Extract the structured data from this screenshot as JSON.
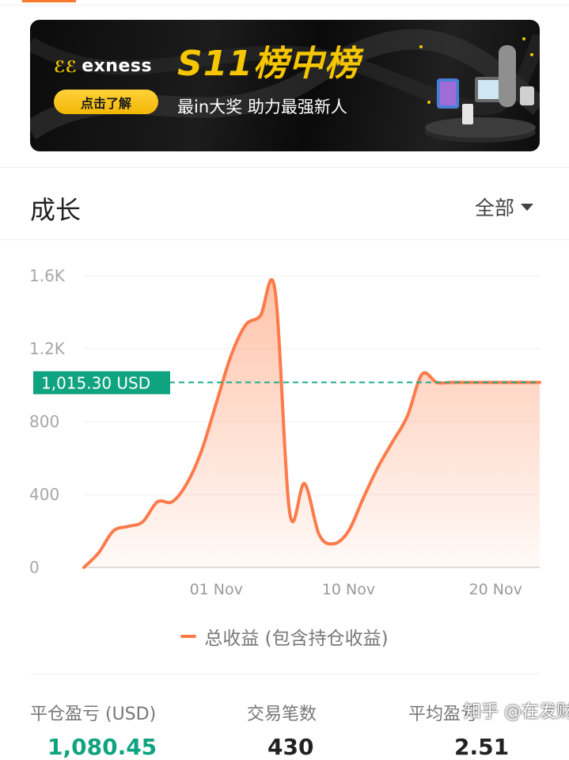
{
  "banner": {
    "brand": "exness",
    "cta": "点击了解",
    "headline": "S11榜中榜",
    "subline": "最in大奖 助力最强新人"
  },
  "section": {
    "title": "成长",
    "filter": "全部"
  },
  "colors": {
    "accent": "#ff7a2e",
    "line": "#ff7a4a",
    "ref_line": "#1aab8a",
    "ref_label_bg": "#10a37f",
    "profit": "#10a37f"
  },
  "chart_data": {
    "type": "area",
    "series": [
      {
        "name": "总收益 (包含持仓收益)",
        "x": [
          "2023-10-23",
          "2023-10-24",
          "2023-10-25",
          "2023-10-26",
          "2023-10-27",
          "2023-10-28",
          "2023-10-29",
          "2023-10-30",
          "2023-10-31",
          "2023-11-01",
          "2023-11-02",
          "2023-11-03",
          "2023-11-04",
          "2023-11-05",
          "2023-11-06",
          "2023-11-07",
          "2023-11-08",
          "2023-11-09",
          "2023-11-10",
          "2023-11-11",
          "2023-11-12",
          "2023-11-13",
          "2023-11-14",
          "2023-11-15",
          "2023-11-16",
          "2023-11-17",
          "2023-11-18",
          "2023-11-19",
          "2023-11-20",
          "2023-11-21",
          "2023-11-22",
          "2023-11-23"
        ],
        "values": [
          0,
          80,
          200,
          225,
          250,
          360,
          360,
          460,
          640,
          900,
          1160,
          1330,
          1380,
          1520,
          300,
          460,
          180,
          130,
          200,
          380,
          550,
          690,
          830,
          1060,
          1015,
          1015,
          1015,
          1015,
          1015,
          1015,
          1015,
          1015
        ]
      }
    ],
    "x_ticks": [
      "01 Nov",
      "10 Nov",
      "20 Nov"
    ],
    "y_ticks": [
      "0",
      "400",
      "800",
      "1.2K",
      "1.6K"
    ],
    "ylim": [
      0,
      1600
    ],
    "grid": true,
    "reference_label": "1,015.30 USD",
    "reference_value": 1015.3,
    "legend_position": "bottom"
  },
  "stats": [
    {
      "label": "平仓盈亏 (USD)",
      "value": "1,080.45"
    },
    {
      "label": "交易笔数",
      "value": "430"
    },
    {
      "label": "平均盈亏",
      "value": "2.51"
    }
  ],
  "watermark": "知乎 @在发财"
}
